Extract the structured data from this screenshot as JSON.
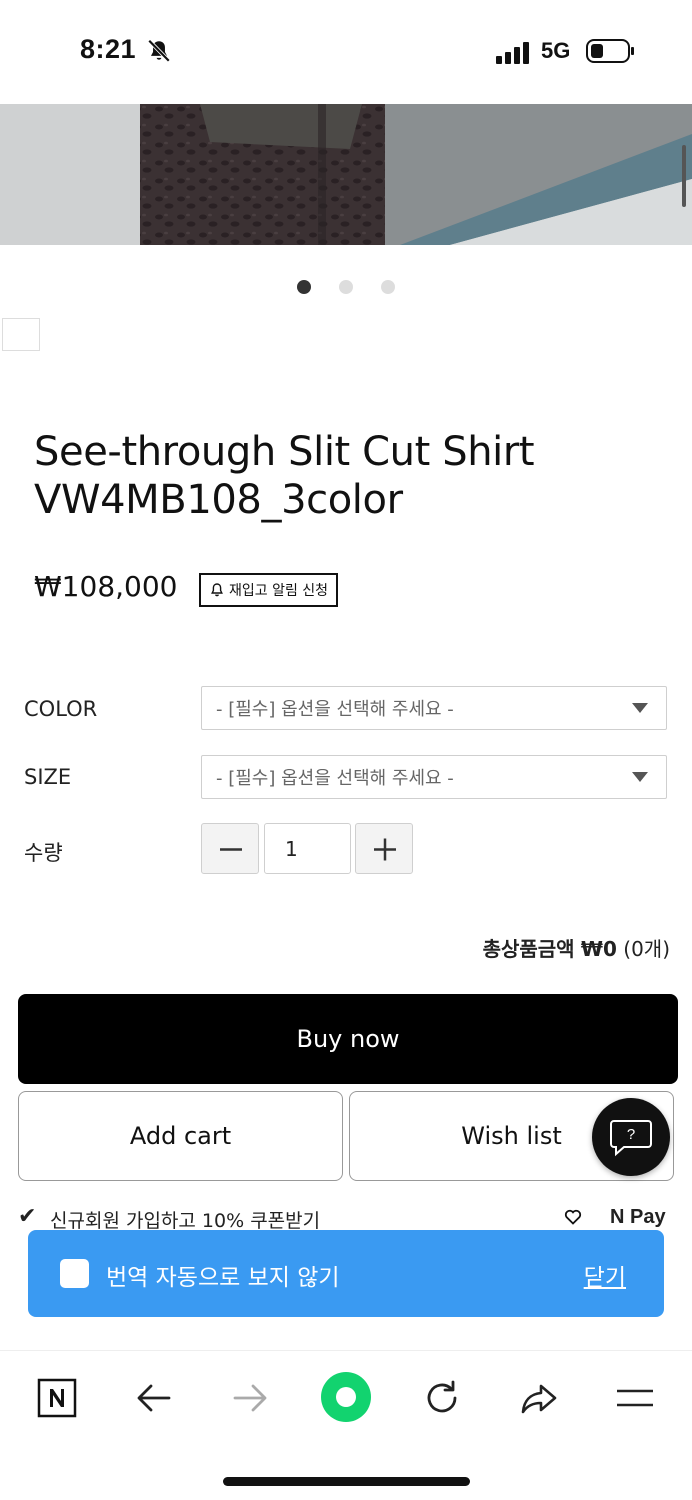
{
  "status_bar": {
    "time": "8:21",
    "network": "5G"
  },
  "gallery": {
    "dots_total": 3,
    "active_index": 0
  },
  "product": {
    "title_line1": "See-through Slit Cut Shirt",
    "title_line2": "VW4MB108_3color",
    "price": "₩108,000",
    "restock_label": "재입고 알림 신청"
  },
  "options": {
    "color_label": "COLOR",
    "color_placeholder": "- [필수] 옵션을 선택해 주세요 -",
    "size_label": "SIZE",
    "size_placeholder": "- [필수] 옵션을 선택해 주세요 -",
    "quantity_label": "수량",
    "quantity_value": "1"
  },
  "total": {
    "label": "총상품금액",
    "amount": "₩0",
    "count": "(0개)"
  },
  "actions": {
    "buy_now": "Buy now",
    "add_cart": "Add cart",
    "wish_list": "Wish list"
  },
  "coupon": {
    "text": "신규회원 가입하고 10% 쿠폰받기",
    "npay": "N Pay"
  },
  "translate_bar": {
    "label": "번역 자동으로 보지 않기",
    "close": "닫기",
    "color": "#3a9af2"
  },
  "toolbar": {
    "icons": [
      "naver-home-icon",
      "back-arrow-icon",
      "forward-arrow-icon",
      "green-dot-icon",
      "reload-icon",
      "share-icon",
      "menu-icon"
    ]
  }
}
